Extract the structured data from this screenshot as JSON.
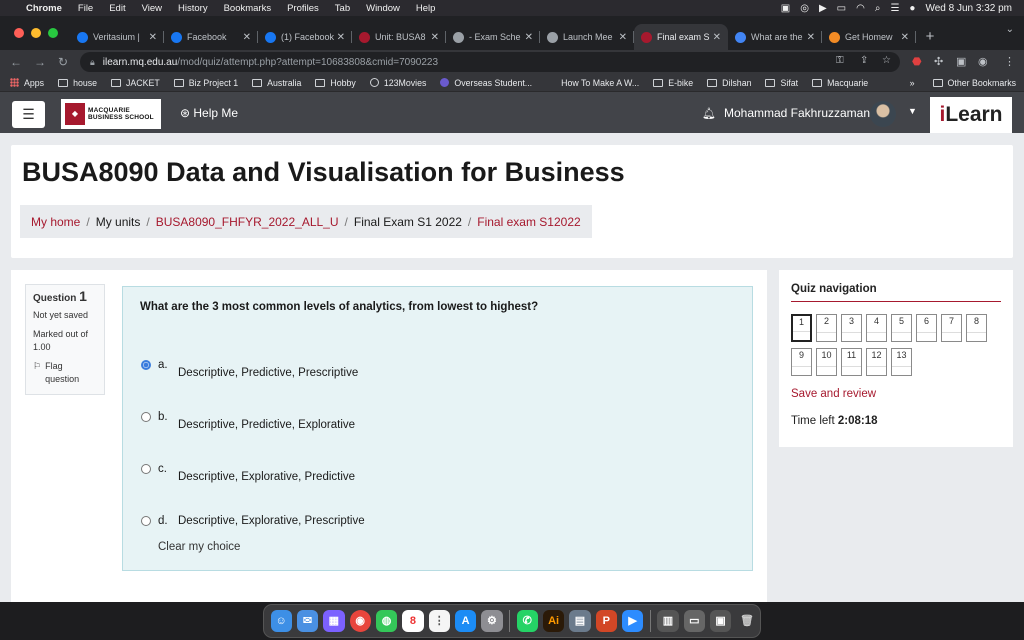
{
  "menubar": {
    "app": "Chrome",
    "items": [
      "File",
      "Edit",
      "View",
      "History",
      "Bookmarks",
      "Profiles",
      "Tab",
      "Window",
      "Help"
    ],
    "datetime": "Wed 8 Jun  3:32 pm"
  },
  "tabs": [
    {
      "label": "Veritasium |",
      "fav": "#1877f2"
    },
    {
      "label": "Facebook",
      "fav": "#1877f2"
    },
    {
      "label": "(1) Facebook",
      "fav": "#1877f2"
    },
    {
      "label": "Unit: BUSA8",
      "fav": "#a6192e"
    },
    {
      "label": "- Exam Sche",
      "fav": "#9aa0a6"
    },
    {
      "label": "Launch Mee",
      "fav": "#9aa0a6"
    },
    {
      "label": "Final exam S",
      "fav": "#a6192e",
      "active": true
    },
    {
      "label": "What are the",
      "fav": "#4285f4"
    },
    {
      "label": "Get Homew",
      "fav": "#f28b25"
    }
  ],
  "address": {
    "host": "ilearn.mq.edu.au",
    "path": "/mod/quiz/attempt.php?attempt=10683808&cmid=7090223"
  },
  "bookmarks": [
    "Apps",
    "house",
    "JACKET",
    "Biz Project 1",
    "Australia",
    "Hobby",
    "123Movies",
    "Overseas Student...",
    "How To Make A W...",
    "E-bike",
    "Dilshan",
    "Sifat",
    "Macquarie"
  ],
  "bookmarks_more": "»",
  "bookmarks_other": "Other Bookmarks",
  "navbar": {
    "logo_text": "MACQUARIE BUSINESS SCHOOL",
    "help": "Help Me",
    "user": "Mohammad Fakhruzzaman",
    "brand_i": "i",
    "brand_rest": "Learn"
  },
  "header": {
    "title": "BUSA8090 Data and Visualisation for Business",
    "breadcrumbs": [
      "My home",
      "My units",
      "BUSA8090_FHFYR_2022_ALL_U",
      "Final Exam S1 2022",
      "Final exam S12022"
    ]
  },
  "question": {
    "label": "Question ",
    "number": "1",
    "status": "Not yet saved",
    "marked": "Marked out of 1.00",
    "flag": "Flag question",
    "text": "What are the 3 most common levels of analytics, from lowest to highest?",
    "options": [
      {
        "letter": "a.",
        "text": "Descriptive, Predictive, Prescriptive",
        "selected": true
      },
      {
        "letter": "b.",
        "text": "Descriptive, Predictive, Explorative",
        "selected": false
      },
      {
        "letter": "c.",
        "text": "Descriptive, Explorative, Predictive",
        "selected": false
      },
      {
        "letter": "d.",
        "text": "Descriptive, Explorative, Prescriptive",
        "selected": false
      }
    ],
    "clear": "Clear my choice"
  },
  "quiznav": {
    "title": "Quiz navigation",
    "questions": [
      "1",
      "2",
      "3",
      "4",
      "5",
      "6",
      "7",
      "8",
      "9",
      "10",
      "11",
      "12",
      "13"
    ],
    "current": "1",
    "save_review": "Save and review",
    "time_label": "Time left ",
    "time_value": "2:08:18"
  },
  "colors": {
    "accent": "#a6192e",
    "navbar": "#424449",
    "question_bg": "#e7f3f5"
  }
}
